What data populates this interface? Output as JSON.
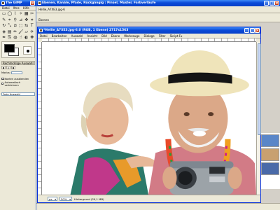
{
  "toolbox": {
    "title": "The GIMP",
    "menu": [
      "Datei",
      "Xtns",
      "Hilfe"
    ],
    "tools": [
      {
        "icon": "rect-select-icon",
        "glyph": "▭"
      },
      {
        "icon": "ellipse-select-icon",
        "glyph": "◯"
      },
      {
        "icon": "free-select-icon",
        "glyph": "⌇"
      },
      {
        "icon": "fuzzy-select-icon",
        "glyph": "✧"
      },
      {
        "icon": "color-select-icon",
        "glyph": "▦"
      },
      {
        "icon": "scissors-icon",
        "glyph": "✂"
      },
      {
        "icon": "paths-icon",
        "glyph": "✎"
      },
      {
        "icon": "color-picker-icon",
        "glyph": "⌖"
      },
      {
        "icon": "zoom-icon",
        "glyph": "⚲"
      },
      {
        "icon": "measure-icon",
        "glyph": "⊿"
      },
      {
        "icon": "move-icon",
        "glyph": "✥"
      },
      {
        "icon": "crop-icon",
        "glyph": "⌗"
      },
      {
        "icon": "rotate-icon",
        "glyph": "↻"
      },
      {
        "icon": "scale-icon",
        "glyph": "⤡"
      },
      {
        "icon": "shear-icon",
        "glyph": "⧄"
      },
      {
        "icon": "perspective-icon",
        "glyph": "⬚"
      },
      {
        "icon": "flip-icon",
        "glyph": "⇆"
      },
      {
        "icon": "text-icon",
        "glyph": "T"
      },
      {
        "icon": "bucket-fill-icon",
        "glyph": "◈"
      },
      {
        "icon": "blend-icon",
        "glyph": "▤"
      },
      {
        "icon": "pencil-icon",
        "glyph": "✏"
      },
      {
        "icon": "paintbrush-icon",
        "glyph": "🖌"
      },
      {
        "icon": "eraser-icon",
        "glyph": "▱"
      },
      {
        "icon": "airbrush-icon",
        "glyph": "✈"
      },
      {
        "icon": "ink-icon",
        "glyph": "✒"
      },
      {
        "icon": "clone-icon",
        "glyph": "⎘"
      },
      {
        "icon": "convolve-icon",
        "glyph": "◍"
      },
      {
        "icon": "smudge-icon",
        "glyph": "☝"
      },
      {
        "icon": "dodge-burn-icon",
        "glyph": "◐"
      },
      {
        "icon": "heal-icon",
        "glyph": "✚"
      }
    ],
    "options_title": "Rechtecklige Auswahl",
    "mode_label": "Modus:",
    "antialias_label": "Kanten ausblenden",
    "feather_label": "Automatisch verkleinern",
    "fixed_label": "Freie Auswahl"
  },
  "bg_window": {
    "title": "Ebenen, Kanäle, Pfade, Rückgängig : Pinsel, Muster, Farbverläufe",
    "file_label": "Hellie_A7XE3.jpg-6",
    "layers_label": "Ebenen"
  },
  "image_window": {
    "title": "*Hellie_A7XE3.jpg-6.0 (RGB, 1 Ebene) 2717x1563",
    "menu": [
      "Datei",
      "Bearbeiten",
      "Auswahl",
      "Ansicht",
      "Bild",
      "Ebene",
      "Werkzeuge",
      "Dialoge",
      "Filter",
      "Skript-Fu"
    ],
    "unit": "px",
    "zoom": "50%",
    "status": "Hintergrund (29,1 MB)"
  },
  "colors": {
    "titlebar": "#0a4ad8",
    "face": "#ece9d8",
    "foreground": "#000000",
    "background": "#ffffff"
  }
}
